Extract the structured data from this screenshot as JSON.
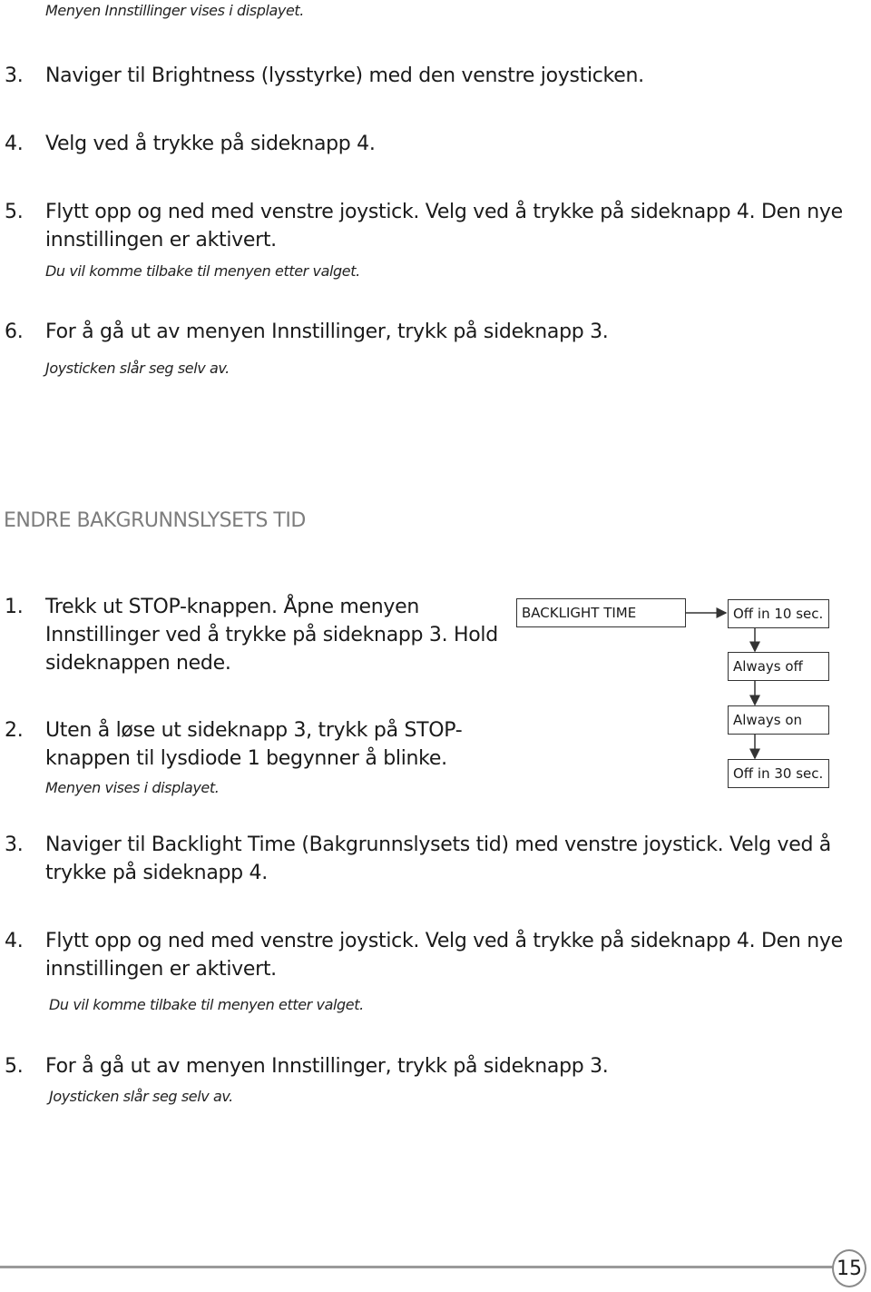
{
  "top_section": {
    "intro_note": "Menyen Innstillinger vises i displayet.",
    "steps": [
      {
        "num": "3.",
        "lines": [
          "Naviger til Brightness (lysstyrke) med den venstre joysticken."
        ]
      },
      {
        "num": "4.",
        "lines": [
          "Velg ved å trykke på sideknapp 4."
        ]
      },
      {
        "num": "5.",
        "lines": [
          "Flytt opp og ned med venstre joystick. Velg ved å trykke på sideknapp 4. Den nye",
          "innstillingen er aktivert."
        ],
        "note": "Du vil komme tilbake til menyen etter valget."
      },
      {
        "num": "6.",
        "lines": [
          "For å gå ut av menyen Innstillinger, trykk på sideknapp 3."
        ],
        "note": "Joysticken slår seg selv av."
      }
    ]
  },
  "section": {
    "heading": "ENDRE BAKGRUNNSLYSETS TID",
    "steps": [
      {
        "num": "1.",
        "lines": [
          "Trekk ut STOP-knappen. Åpne menyen",
          "Innstillinger ved å trykke på sideknapp 3. Hold",
          "sideknappen nede."
        ]
      },
      {
        "num": "2.",
        "lines": [
          "Uten å løse ut sideknapp 3, trykk på STOP-",
          "knappen til lysdiode 1 begynner å blinke."
        ],
        "note": "Menyen vises i displayet."
      },
      {
        "num": "3.",
        "lines": [
          "Naviger til Backlight Time (Bakgrunnslysets tid) med venstre joystick. Velg ved å",
          "trykke på sideknapp 4."
        ]
      },
      {
        "num": "4.",
        "lines": [
          "Flytt opp og ned med venstre joystick. Velg ved å trykke på sideknapp 4. Den nye",
          "innstillingen er aktivert."
        ],
        "note": "Du vil komme tilbake til menyen etter valget."
      },
      {
        "num": "5.",
        "lines": [
          "For å gå ut av menyen Innstillinger, trykk på sideknapp 3."
        ],
        "note": "Joysticken slår seg selv av."
      }
    ]
  },
  "diagram": {
    "menu_label": "BACKLIGHT TIME",
    "options": [
      "Off in 10 sec.",
      "Always off",
      "Always on",
      "Off in 30 sec."
    ]
  },
  "footer": {
    "page_number": "15"
  }
}
